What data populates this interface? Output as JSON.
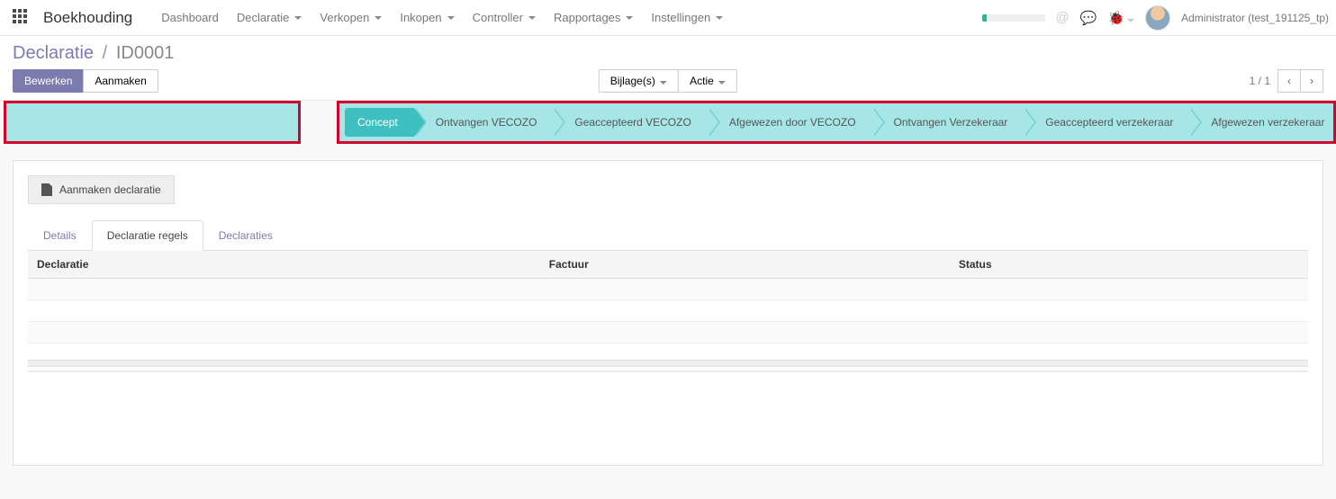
{
  "navbar": {
    "app_name": "Boekhouding",
    "menu": [
      "Dashboard",
      "Declaratie",
      "Verkopen",
      "Inkopen",
      "Controller",
      "Rapportages",
      "Instellingen"
    ],
    "menu_has_caret": [
      false,
      true,
      true,
      true,
      true,
      true,
      true
    ],
    "user_label": "Administrator (test_191125_tp)"
  },
  "breadcrumb": {
    "parent": "Declaratie",
    "current": "ID0001"
  },
  "actions": {
    "edit": "Bewerken",
    "create": "Aanmaken",
    "attachments": "Bijlage(s)",
    "action": "Actie"
  },
  "pager": {
    "text": "1 / 1"
  },
  "statusbar": {
    "steps": [
      "Concept",
      "Ontvangen VECOZO",
      "Geaccepteerd VECOZO",
      "Afgewezen door VECOZO",
      "Ontvangen Verzekeraar",
      "Geaccepteerd verzekeraar",
      "Afgewezen verzekeraar"
    ],
    "active_index": 0
  },
  "form": {
    "button_create_decl": "Aanmaken declaratie"
  },
  "tabs": {
    "items": [
      "Details",
      "Declaratie regels",
      "Declaraties"
    ],
    "active_index": 1
  },
  "table": {
    "columns": [
      "Declaratie",
      "Factuur",
      "Status"
    ]
  },
  "colors": {
    "highlight_border": "#d2042d",
    "status_bg": "#a6e6e6",
    "status_active": "#3fbfbf",
    "primary": "#7c7bad"
  }
}
